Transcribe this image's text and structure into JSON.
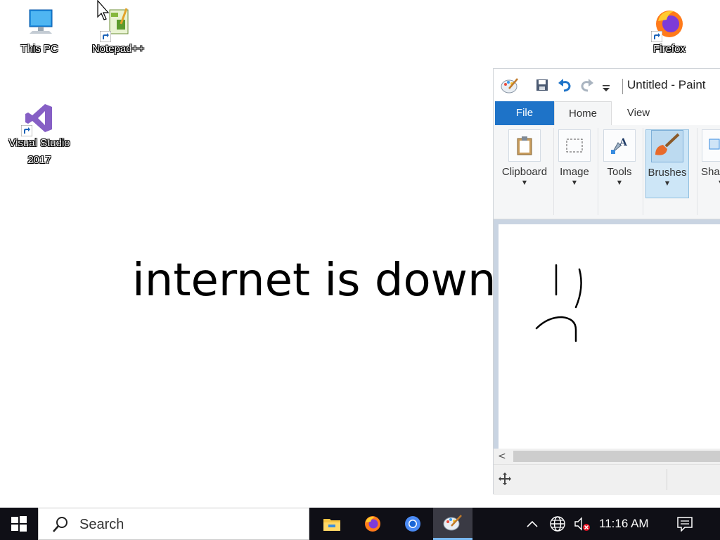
{
  "desktop": {
    "icons": [
      {
        "label": "This PC",
        "icon": "computer-icon"
      },
      {
        "label": "Notepad++",
        "icon": "notepad-plus-plus-icon"
      },
      {
        "label": "Firefox",
        "icon": "firefox-icon"
      },
      {
        "label_line1": "Visual Studio",
        "label_line2": "2017",
        "icon": "visual-studio-icon"
      }
    ],
    "message": "internet is down"
  },
  "paint": {
    "title": "Untitled - Paint",
    "quick_access": [
      "paint-app-icon",
      "save-icon",
      "undo-icon",
      "redo-icon",
      "customize-dropdown-icon"
    ],
    "tabs": [
      {
        "label": "File",
        "selected": false
      },
      {
        "label": "Home",
        "selected": true
      },
      {
        "label": "View",
        "selected": false
      }
    ],
    "ribbon_groups": [
      {
        "label": "Clipboard",
        "icon": "clipboard-icon",
        "active": false
      },
      {
        "label": "Image",
        "icon": "select-icon",
        "active": false
      },
      {
        "label": "Tools",
        "icon": "tools-icon",
        "active": false
      },
      {
        "label": "Brushes",
        "icon": "brush-icon",
        "active": true
      },
      {
        "label": "Shap",
        "icon": "shapes-icon",
        "active": false
      }
    ],
    "accent_color": "#1e73c8"
  },
  "taskbar": {
    "search_placeholder": "Search",
    "apps": [
      "file-explorer-icon",
      "firefox-icon",
      "chrome-icon",
      "paint-icon"
    ],
    "active_app": "paint-icon",
    "tray": [
      "show-hidden-icons-icon",
      "network-globe-icon",
      "volume-muted-icon"
    ],
    "time": "11:16 AM",
    "notification_icon": "action-center-icon"
  }
}
